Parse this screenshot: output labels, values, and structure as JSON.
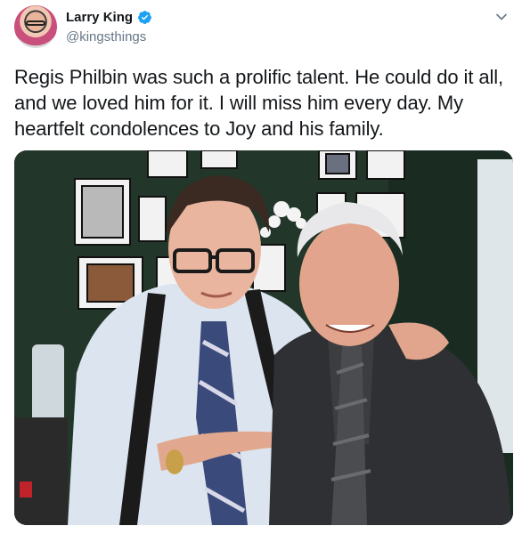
{
  "author": {
    "name": "Larry King",
    "handle": "@kingsthings",
    "verified": true
  },
  "tweet": {
    "text": "Regis Philbin was such a prolific talent. He could do it all, and we loved him for it. I will miss him every day. My heartfelt condolences to Joy and his family."
  },
  "icons": {
    "verified": "verified-badge-icon",
    "menu": "chevron-down-icon"
  },
  "colors": {
    "verified": "#1da1f2",
    "handle": "#657786",
    "text": "#14171a"
  }
}
